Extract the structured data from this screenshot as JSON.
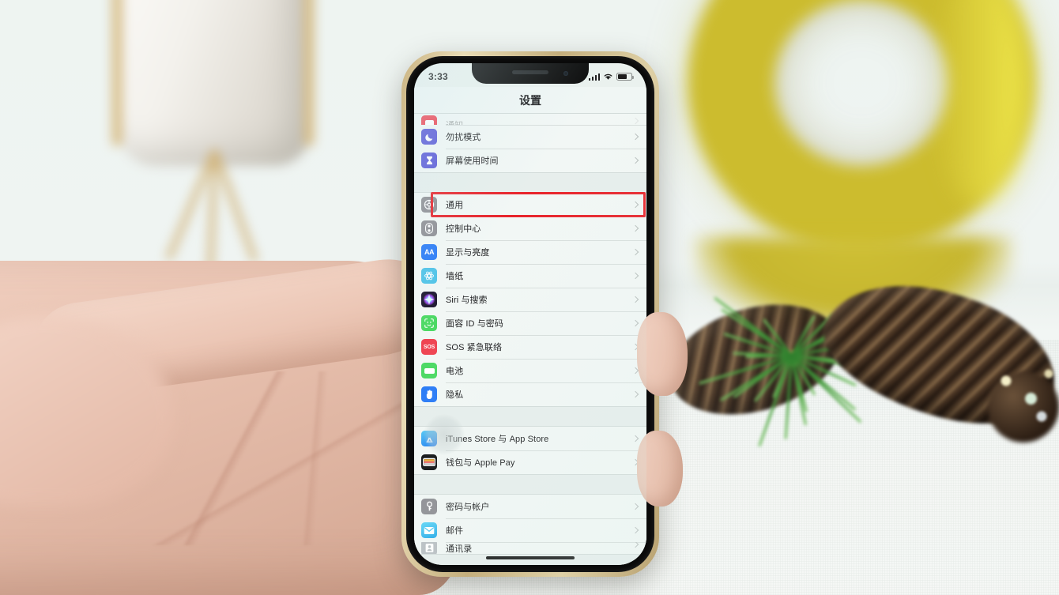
{
  "scene": {
    "description": "hand-held iPhone showing Chinese iOS Settings list with red highlight box",
    "background_objects": [
      {
        "name": "white-planter",
        "detail": "blurred white ceramic pot on gold tripod stand"
      },
      {
        "name": "yellow-ring",
        "detail": "blurred yellow torus decoration"
      },
      {
        "name": "pinecones",
        "detail": "two brown pinecones with green pine needles"
      },
      {
        "name": "fairy-lights",
        "detail": "small clear string lights"
      },
      {
        "name": "table-surface",
        "detail": "white woven fabric tabletop"
      }
    ]
  },
  "phone": {
    "frame_color": "#cbb584",
    "bezel_color": "#0a0a0a"
  },
  "status_bar": {
    "time": "3:33",
    "signal_icon": "cellular-signal-icon",
    "wifi_icon": "wifi-icon",
    "battery_icon": "battery-icon",
    "battery_level": "60"
  },
  "nav": {
    "title": "设置"
  },
  "highlight": {
    "color": "#e8232a",
    "target_row": "通用"
  },
  "settings": {
    "group_partial_top": [
      {
        "label": "通知",
        "icon": "notifications-icon",
        "icon_color": "#ef4452",
        "clipped": true
      },
      {
        "label": "勿扰模式",
        "icon": "do-not-disturb-icon",
        "icon_color": "#5856d6"
      },
      {
        "label": "屏幕使用时间",
        "icon": "screen-time-icon",
        "icon_color": "#5856d6"
      }
    ],
    "group_system": [
      {
        "label": "通用",
        "icon": "general-gear-icon",
        "icon_color": "#8e8e93",
        "highlighted": true
      },
      {
        "label": "控制中心",
        "icon": "control-center-icon",
        "icon_color": "#8e8e93"
      },
      {
        "label": "显示与亮度",
        "icon": "display-brightness-icon",
        "icon_color": "#2a7bf6"
      },
      {
        "label": "墙纸",
        "icon": "wallpaper-icon",
        "icon_color": "#4fc3e8"
      },
      {
        "label": "Siri 与搜索",
        "icon": "siri-icon",
        "icon_color": "#2b2440"
      },
      {
        "label": "面容 ID 与密码",
        "icon": "face-id-icon",
        "icon_color": "#4cd964"
      },
      {
        "label": "SOS 紧急联络",
        "icon": "sos-icon",
        "icon_color": "#ef4452"
      },
      {
        "label": "电池",
        "icon": "battery-settings-icon",
        "icon_color": "#4cd964"
      },
      {
        "label": "隐私",
        "icon": "privacy-hand-icon",
        "icon_color": "#2a7bf6"
      }
    ],
    "group_stores": [
      {
        "label": "iTunes Store 与 App Store",
        "icon": "app-store-icon",
        "icon_color": "#3b9cf5",
        "glare": true
      },
      {
        "label": "钱包与 Apple Pay",
        "icon": "wallet-icon",
        "icon_color": "#1c1c1e"
      }
    ],
    "group_accounts": [
      {
        "label": "密码与帐户",
        "icon": "passwords-key-icon",
        "icon_color": "#8e8e93"
      },
      {
        "label": "邮件",
        "icon": "mail-icon",
        "icon_color": "#3ec0f0"
      },
      {
        "label": "通讯录",
        "icon": "contacts-icon",
        "icon_color": "#8e8e93",
        "clipped": true
      }
    ]
  }
}
